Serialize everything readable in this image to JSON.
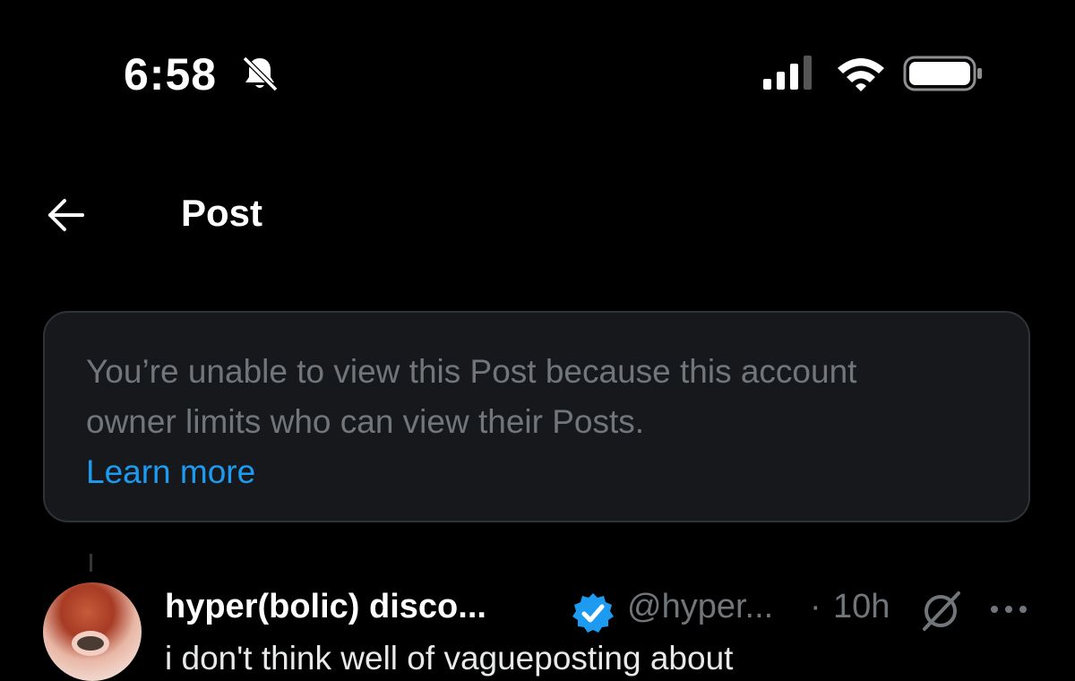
{
  "status_bar": {
    "time": "6:58",
    "icons": [
      "bell-off-icon",
      "cellular-signal-icon",
      "wifi-icon",
      "battery-icon"
    ]
  },
  "nav": {
    "title": "Post",
    "back_icon": "arrow-left-icon"
  },
  "notice": {
    "message": "You’re unable to view this Post because this account owner limits who can view their Posts.",
    "link_label": "Learn more"
  },
  "post": {
    "author_name": "hyper(bolic) disco...",
    "handle": "@hyper...",
    "separator": "·",
    "time": "10h",
    "text": "i don't think well of vagueposting about"
  },
  "colors": {
    "background": "#000000",
    "card": "#16181c",
    "muted": "#71767b",
    "link": "#1d9bf0",
    "verified": "#1d9bf0"
  }
}
